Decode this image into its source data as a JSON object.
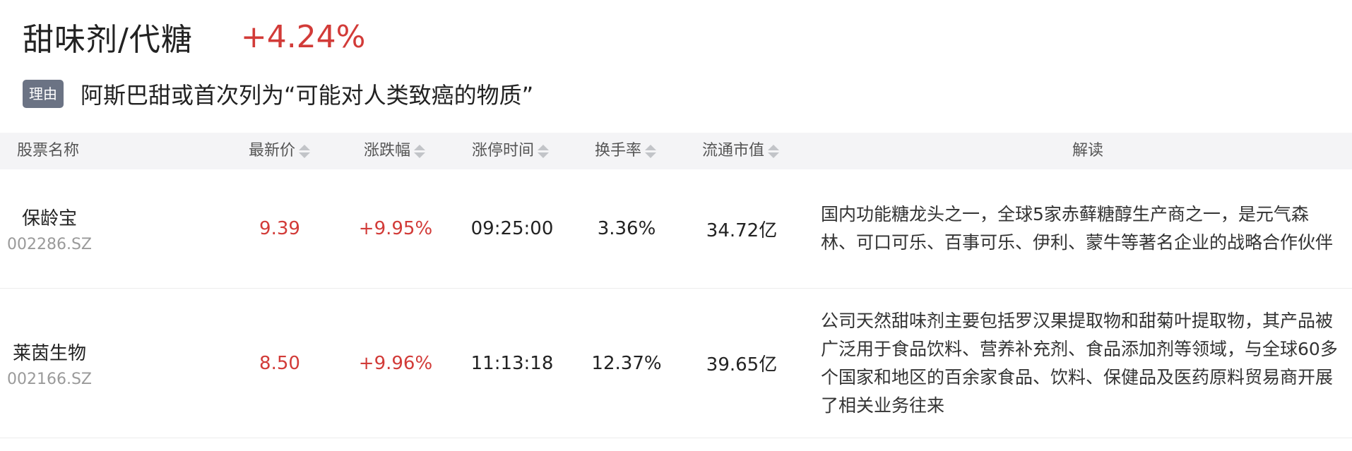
{
  "sector": {
    "name": "甜味剂/代糖",
    "change": "+4.24%"
  },
  "reason": {
    "badge": "理由",
    "text": "阿斯巴甜或首次列为“可能对人类致癌的物质”"
  },
  "table": {
    "headers": {
      "name": "股票名称",
      "price": "最新价",
      "pct": "涨跌幅",
      "limit_time": "涨停时间",
      "turnover": "换手率",
      "market_cap": "流通市值",
      "desc": "解读"
    },
    "rows": [
      {
        "name": "保龄宝",
        "code": "002286.SZ",
        "price": "9.39",
        "pct": "+9.95%",
        "limit_time": "09:25:00",
        "turnover": "3.36%",
        "market_cap": "34.72亿",
        "desc": "国内功能糖龙头之一，全球5家赤藓糖醇生产商之一，是元气森林、可口可乐、百事可乐、伊利、蒙牛等著名企业的战略合作伙伴"
      },
      {
        "name": "莱茵生物",
        "code": "002166.SZ",
        "price": "8.50",
        "pct": "+9.96%",
        "limit_time": "11:13:18",
        "turnover": "12.37%",
        "market_cap": "39.65亿",
        "desc": "公司天然甜味剂主要包括罗汉果提取物和甜菊叶提取物，其产品被广泛用于食品饮料、营养补充剂、食品添加剂等领域，与全球60多个国家和地区的百余家食品、饮料、保健品及医药原料贸易商开展了相关业务往来"
      }
    ]
  },
  "colors": {
    "up": "#d23b38",
    "header_bg": "#f4f4f6",
    "badge_bg": "#6b7384"
  }
}
